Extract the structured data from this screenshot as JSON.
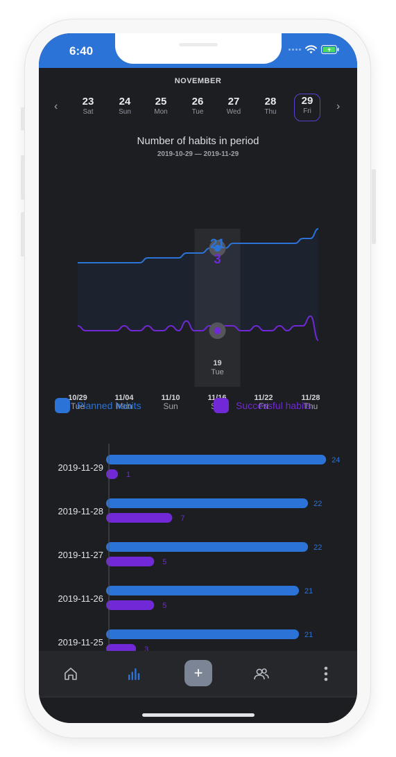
{
  "status": {
    "time": "6:40"
  },
  "calendar": {
    "month": "NOVEMBER",
    "days": [
      {
        "num": "23",
        "name": "Sat"
      },
      {
        "num": "24",
        "name": "Sun"
      },
      {
        "num": "25",
        "name": "Mon"
      },
      {
        "num": "26",
        "name": "Tue"
      },
      {
        "num": "27",
        "name": "Wed"
      },
      {
        "num": "28",
        "name": "Thu"
      },
      {
        "num": "29",
        "name": "Fri"
      }
    ],
    "prev": "‹",
    "next": "›"
  },
  "chart": {
    "title": "Number of habits in period",
    "subtitle": "2019-10-29 — 2019-11-29",
    "tooltip": {
      "planned": "21",
      "successful": "3",
      "date": "19",
      "weekday": "Tue"
    },
    "x_labels": [
      {
        "date": "10/29",
        "day": "Tue"
      },
      {
        "date": "11/04",
        "day": "Mon"
      },
      {
        "date": "11/10",
        "day": "Sun"
      },
      {
        "date": "11/16",
        "day": "Sat"
      },
      {
        "date": "11/22",
        "day": "Fri"
      },
      {
        "date": "11/28",
        "day": "Thu"
      }
    ]
  },
  "legend": {
    "planned": "Planned habits",
    "successful": "Successful habits"
  },
  "colors": {
    "planned": "#2b73d6",
    "successful": "#7128d6",
    "bg": "#1d1e22",
    "statusbar": "#2b73d6"
  },
  "chart_data": [
    {
      "type": "line",
      "x": [
        "10/29",
        "10/30",
        "10/31",
        "11/01",
        "11/02",
        "11/03",
        "11/04",
        "11/05",
        "11/06",
        "11/07",
        "11/08",
        "11/09",
        "11/10",
        "11/11",
        "11/12",
        "11/13",
        "11/14",
        "11/15",
        "11/16",
        "11/17",
        "11/18",
        "11/19",
        "11/20",
        "11/21",
        "11/22",
        "11/23",
        "11/24",
        "11/25",
        "11/26",
        "11/27",
        "11/28",
        "11/29"
      ],
      "series": [
        {
          "name": "Planned habits",
          "values": [
            17,
            17,
            17,
            17,
            17,
            17,
            17,
            17,
            17,
            18,
            18,
            18,
            18,
            18,
            19,
            19,
            19,
            20,
            20,
            20,
            21,
            21,
            21,
            21,
            21,
            21,
            21,
            21,
            21,
            22,
            22,
            24
          ]
        },
        {
          "name": "Successful habits",
          "values": [
            4,
            3,
            3,
            3,
            3,
            3,
            4,
            3,
            3,
            4,
            3,
            3,
            4,
            3,
            5,
            3,
            3,
            4,
            3,
            4,
            4,
            3,
            3,
            4,
            3,
            3,
            4,
            3,
            4,
            4,
            6,
            1
          ]
        }
      ]
    },
    {
      "type": "bar",
      "categories": [
        "2019-11-29",
        "2019-11-28",
        "2019-11-27",
        "2019-11-26",
        "2019-11-25"
      ],
      "series": [
        {
          "name": "Planned habits",
          "values": [
            24,
            22,
            22,
            21,
            21
          ]
        },
        {
          "name": "Successful habits",
          "values": [
            1,
            7,
            5,
            5,
            3
          ]
        }
      ]
    }
  ]
}
